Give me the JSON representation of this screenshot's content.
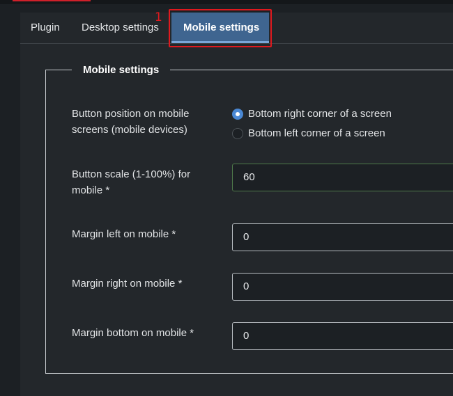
{
  "annotation": {
    "step": "1"
  },
  "tabs": [
    {
      "label": "Plugin",
      "active": false
    },
    {
      "label": "Desktop settings",
      "active": false
    },
    {
      "label": "Mobile settings",
      "active": true
    }
  ],
  "section": {
    "legend": "Mobile settings"
  },
  "fields": {
    "position": {
      "label": "Button position on mobile screens (mobile devices)",
      "options": [
        {
          "label": "Bottom right corner of a screen",
          "checked": true
        },
        {
          "label": "Bottom left corner of a screen",
          "checked": false
        }
      ]
    },
    "scale": {
      "label": "Button scale (1-100%) for mobile *",
      "value": "60"
    },
    "margin_left": {
      "label": "Margin left on mobile *",
      "value": "0"
    },
    "margin_right": {
      "label": "Margin right on mobile *",
      "value": "0"
    },
    "margin_bottom": {
      "label": "Margin bottom on mobile *",
      "value": "0"
    }
  },
  "colors": {
    "active_tab": "#3f6590",
    "annotation": "#e0191e",
    "radio_checked": "#4a88d4",
    "valid_border": "#4e7a4a"
  }
}
